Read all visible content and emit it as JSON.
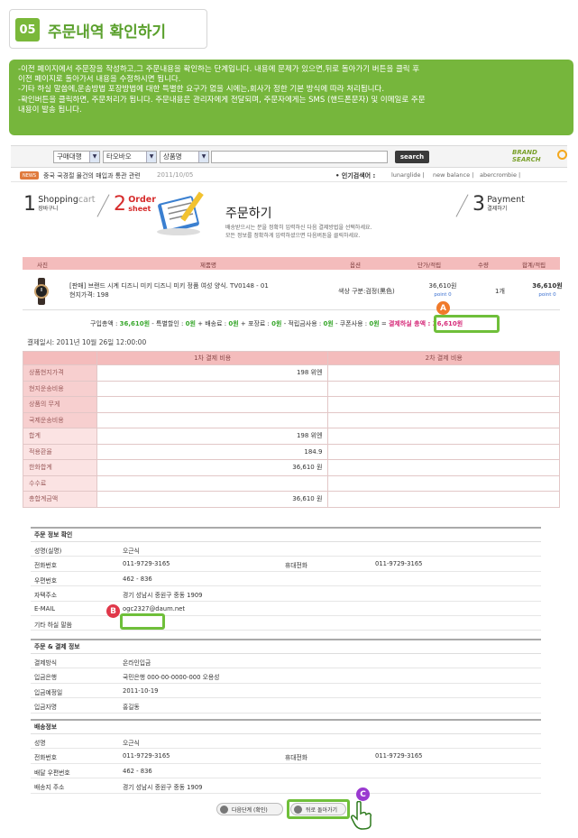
{
  "heading": {
    "number": "05",
    "title": "주문내역 확인하기"
  },
  "instructions": [
    "-이전 페이지에서 주문장을 작성하고,그 주문내용을 확인하는 단계입니다.  내용에 문제가 있으면,뒤로 돌아가기 버튼을 클릭 후",
    "  이전 페이지로 돌아가서 내용을 수정하시면 됩니다.",
    "-기타 하실 말씀에,운송방법 포장방법에 대한 특별한 요구가 없을 시에는,회사가 정한 기본 방식에 따라 처리됩니다.",
    "-확인버튼을 클릭하면, 주문처리가 됩니다. 주문내용은 관리자에게 전달되며, 주문자에게는 SMS (핸드폰문자) 및 이메일로 주문",
    "  내용이 발송 됩니다."
  ],
  "search": {
    "select1": "구매대행",
    "select2": "타오바오",
    "select3": "상품명",
    "input_value": "",
    "button": "search",
    "brand_line1": "BRAND",
    "brand_line2": "SEARCH"
  },
  "news": {
    "badge": "NEWS",
    "text": "중국 국경절 물건의 매입과 통관 관련",
    "date": "2011/10/05",
    "hot_label": "• 인기검색어 :",
    "hot_items": [
      "lunarglide |",
      "new balance |",
      "abercrombie |"
    ]
  },
  "steps": {
    "s1_num": "1",
    "s1_en": "Shopping",
    "s1_en2": "cart",
    "s1_ko": "장바구니",
    "s2_num": "2",
    "s2_en": "Order",
    "s2_en2": "sheet",
    "s3_num": "3",
    "s3_en": "Payment",
    "s3_ko": "결제하기",
    "title": "주문하기",
    "desc1": "배송받으시는 분을 정확히 입력하신 다음 결제방법을 선택하세요.",
    "desc2": "모든 정보를 정확하게 입력하셨으면 다음버튼을 클릭하세요."
  },
  "product_table": {
    "headers": [
      "사진",
      "제품명",
      "옵션",
      "단가/적립",
      "수량",
      "합계/적립"
    ],
    "row": {
      "name_line1": "[판매] 브랜드 시계 디즈니 미키 디즈니 미키 정품 여성 양식. TV0148 - 01",
      "name_line2": "현지가격: 198",
      "option": "색상 구분:검정(黑色)",
      "price": "36,610원",
      "price_point": "point 0",
      "qty": "1개",
      "sum": "36,610원",
      "sum_point": "point 0"
    }
  },
  "totals": {
    "t1": "구입총액 : ",
    "v1": "36,610원",
    "t2": " - 특별할인 : ",
    "v2": "0원",
    "t3": " + 배송료 : ",
    "v3": "0원",
    "t4": " + 포장료 : ",
    "v4": "0원",
    "t5": " - 적립금사용 : ",
    "v5": "0원",
    "t6": " - 쿠폰사용 : ",
    "v6": "0원",
    "t7": " = ",
    "v7": "결제하실 총액 : 36,610원"
  },
  "paydate": "결제일시: 2011년 10월 26일    12:00:00",
  "cost_table": {
    "headers": [
      "",
      "1차 결제 비용",
      "2차 결제 비용"
    ],
    "rows": [
      {
        "label": "상품현지가격",
        "v1": "198 위엔"
      },
      {
        "label": "현지운송비용",
        "v1": ""
      },
      {
        "label": "상품의 무게",
        "v1": ""
      },
      {
        "label": "국제운송비용",
        "v1": ""
      },
      {
        "label": "합계",
        "v1": "198 위엔"
      },
      {
        "label": "적용환율",
        "v1": "184.9"
      },
      {
        "label": "한화합계",
        "v1": "36,610 원"
      },
      {
        "label": "수수료",
        "v1": ""
      },
      {
        "label": "총합계금액",
        "v1": "36,610 원"
      }
    ]
  },
  "order_info": {
    "title": "주문 정보 확인",
    "name_label": "성명(실명)",
    "name": "오근식",
    "phone_label": "전화번호",
    "phone": "011-9729-3165",
    "mobile_label": "휴대전화",
    "mobile": "011-9729-3165",
    "zip_label": "우편번호",
    "zip": "462 - 836",
    "addr_label": "자택주소",
    "addr": "경기 성남시 중원구 중동 1909",
    "email_label": "E-MAIL",
    "email": "ogc2327@daum.net",
    "memo_label": "기타 하실 말씀",
    "memo": ""
  },
  "payment_info": {
    "title": "주문 & 결제 정보",
    "method_label": "결제방식",
    "method": "온라인입금",
    "bank_label": "입금은행",
    "bank": "국민은행 000-00-0000-000 오용성",
    "date_label": "입금예정일",
    "date": "2011-10-19",
    "payer_label": "입금자명",
    "payer": "홍길동"
  },
  "ship_info": {
    "title": "배송정보",
    "name_label": "성명",
    "name": "오근식",
    "phone_label": "전화번호",
    "phone": "011-9729-3165",
    "mobile_label": "휴대전화",
    "mobile": "011-9729-3165",
    "zip_label": "배달 우편번호",
    "zip": "462 - 836",
    "addr_label": "배송지 주소",
    "addr": "경기 성남시 중원구 중동 1909"
  },
  "buttons": {
    "next": "다음단계 (확인)",
    "back": "뒤로 돌아가기"
  },
  "markers": {
    "a": "A",
    "b": "B",
    "c": "C"
  },
  "colors": {
    "accent_green": "#76b63c",
    "step_red": "#d62c2c",
    "table_pink": "#f4bcbc",
    "highlight": "#6fbf3a"
  }
}
